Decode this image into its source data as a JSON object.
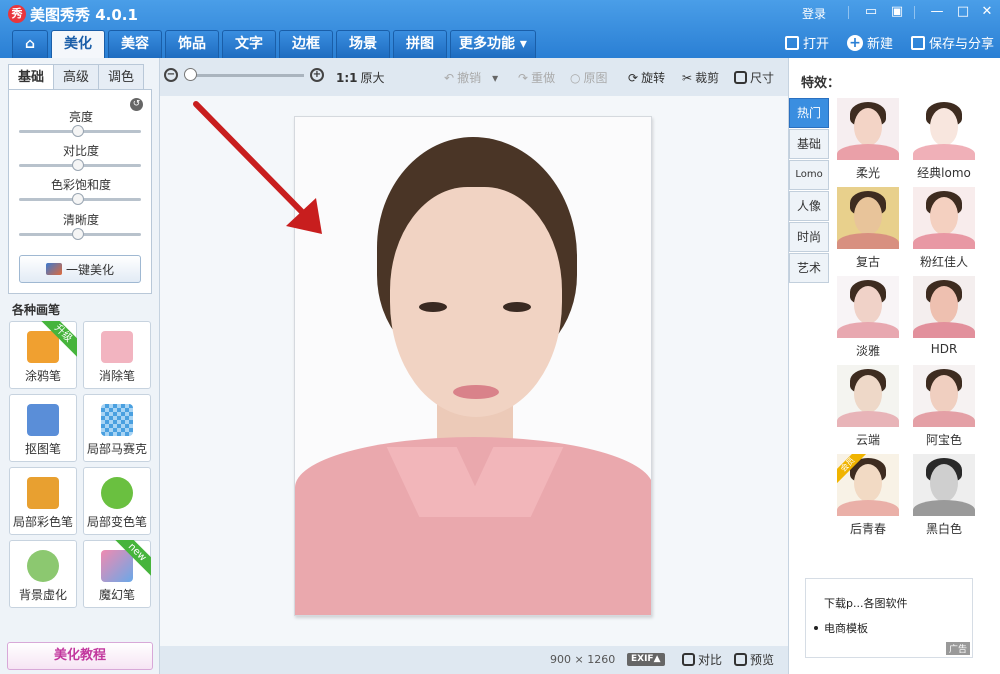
{
  "titlebar": {
    "logo_glyph": "秀",
    "title": "美图秀秀 4.0.1",
    "login": "登录"
  },
  "nav": {
    "tabs": [
      "美化",
      "美容",
      "饰品",
      "文字",
      "边框",
      "场景",
      "拼图",
      "更多功能 ▾"
    ],
    "active": "美化"
  },
  "top_actions": {
    "open": "打开",
    "new": "新建",
    "save": "保存与分享"
  },
  "left": {
    "subtabs": [
      "基础",
      "高级",
      "调色"
    ],
    "sliders": [
      {
        "label": "亮度",
        "value": 0.5
      },
      {
        "label": "对比度",
        "value": 0.5
      },
      {
        "label": "色彩饱和度",
        "value": 0.5
      },
      {
        "label": "清晰度",
        "value": 0.5
      }
    ],
    "one_key": "一键美化",
    "brushes_title": "各种画笔",
    "brushes": [
      {
        "label": "涂鸦笔",
        "ribbon": "升级",
        "color": "#f0a030"
      },
      {
        "label": "消除笔",
        "ribbon": "",
        "color": "#f2b4c0"
      },
      {
        "label": "抠图笔",
        "ribbon": "",
        "color": "#5a8ed8"
      },
      {
        "label": "局部马赛克",
        "ribbon": "",
        "color": "#4aa0e0"
      },
      {
        "label": "局部彩色笔",
        "ribbon": "",
        "color": "#e8a030"
      },
      {
        "label": "局部变色笔",
        "ribbon": "",
        "color": "#6ac040"
      },
      {
        "label": "背景虚化",
        "ribbon": "",
        "color": "#8cc870"
      },
      {
        "label": "魔幻笔",
        "ribbon": "new",
        "color": "#f08ab0"
      }
    ],
    "tutorial": "美化教程"
  },
  "toolbar": {
    "zoom_ratio": "1:1",
    "original_size": "原大",
    "undo": "撤销",
    "redo": "重做",
    "original": "原图",
    "rotate": "旋转",
    "crop": "裁剪",
    "resize": "尺寸"
  },
  "status": {
    "width": "900",
    "times": "×",
    "height": "1260",
    "exif": "EXIF▲",
    "compare": "对比",
    "preview": "预览"
  },
  "right": {
    "title": "特效：",
    "categories": [
      "热门",
      "基础",
      "Lomo",
      "人像",
      "时尚",
      "艺术"
    ],
    "active_category": "热门",
    "effects": [
      {
        "label": "柔光",
        "bg": "#f6eef0",
        "face": "#f3d4c6",
        "shirt": "#eaa0a8"
      },
      {
        "label": "经典lomo",
        "bg": "#ffffff",
        "face": "#f8e6de",
        "shirt": "#f0b0b8"
      },
      {
        "label": "复古",
        "bg": "#e8d08c",
        "face": "#e8c49a",
        "shirt": "#d89080"
      },
      {
        "label": "粉红佳人",
        "bg": "#f8ecec",
        "face": "#f4d0c0",
        "shirt": "#e898a4"
      },
      {
        "label": "淡雅",
        "bg": "#f8f4f6",
        "face": "#f0d2c8",
        "shirt": "#e8a8b0"
      },
      {
        "label": "HDR",
        "bg": "#f4eeee",
        "face": "#eec0b0",
        "shirt": "#e2909c"
      },
      {
        "label": "云端",
        "bg": "#f4f4f0",
        "face": "#eed8c8",
        "shirt": "#e8b4b8"
      },
      {
        "label": "阿宝色",
        "bg": "#f6f2f2",
        "face": "#f0cfc0",
        "shirt": "#e4a0a6"
      },
      {
        "label": "后青春",
        "bg": "#f8f2e6",
        "face": "#f2dac4",
        "shirt": "#eab0a8",
        "vip": "会员"
      },
      {
        "label": "黑白色",
        "bg": "#eeeeee",
        "face": "#cfcfcf",
        "shirt": "#9a9a9a"
      }
    ],
    "ad": {
      "line1": "下载p...各图软件",
      "line2": "电商模板",
      "tag": "广告"
    }
  },
  "colors": {
    "accent": "#2a7fd4",
    "arrow": "#c81e1e"
  }
}
